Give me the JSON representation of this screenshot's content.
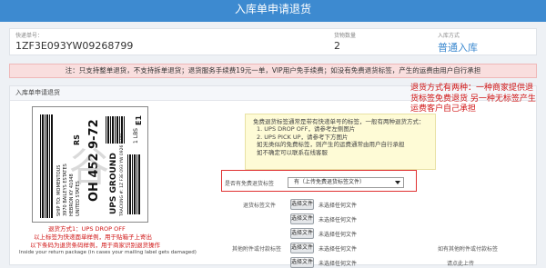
{
  "header": {
    "title": "入库单申请退货"
  },
  "info": {
    "tracking_label": "快递单号：",
    "tracking_value": "1ZF3E093YW09268799",
    "qty_label": "货物数量",
    "qty_value": "2",
    "type_label": "入库方式",
    "type_value": "普通入库"
  },
  "notice": "注：只支持整单退货，不支持拆单退货；退货服务手续费19元一单，VIP用户免手续费；如没有免费退货标签，产生的运费由用户自行承担",
  "panel": {
    "title": "入库单申请退货"
  },
  "label_image": {
    "ship_to_lines": [
      "SHIP TO: MOMENTOUS",
      "3970 BAILEYS ESTATES",
      "HEBRON KY 41048",
      "UNITED STATES"
    ],
    "rs_code": "RS",
    "zip_code": "OH 452 9-72",
    "service": "UPS GROUND",
    "tracking": "TRACKING #: 1Z F3E 093 YW 0926 8799",
    "weight": "1 LBS",
    "code_e1": "E1",
    "red_line1": "退货方式1：UPS DROP OFF",
    "red_line2": "以上标签为快递面单样例，用于贴箱子上寄出",
    "red_line3": "以下条码为退货条码样例，用于商家识别退货操作",
    "footer": "Inside your return package (in cases your mailing label gets damaged)"
  },
  "info_box": {
    "lines": [
      "免费退货标签通常是带有快递单号的标签，一般有两种退货方式：",
      "1. UPS DROP OFF，请参考左侧图片",
      "2. UPS PICK UP，请参考下方图片",
      "如无类似的免费标签，则产生的运费通常由用户自行承担",
      "如不确定可以联系在线客服"
    ]
  },
  "form": {
    "free_label_label": "是否有免费退货标签",
    "free_label_value": "有（上传免费退货标签文件）",
    "return_label_label": "退货标签文件",
    "other_label_label": "其他附件或付款标签",
    "choose_file": "选择文件",
    "no_file": "未选择任何文件",
    "other_note": "如有其他附件或付款标签",
    "upload_note": "请点此上传"
  },
  "annotation": "退货方式有两种：一种商家提供退货标签免费退货 另一种无标签产生运费客户自己承担"
}
